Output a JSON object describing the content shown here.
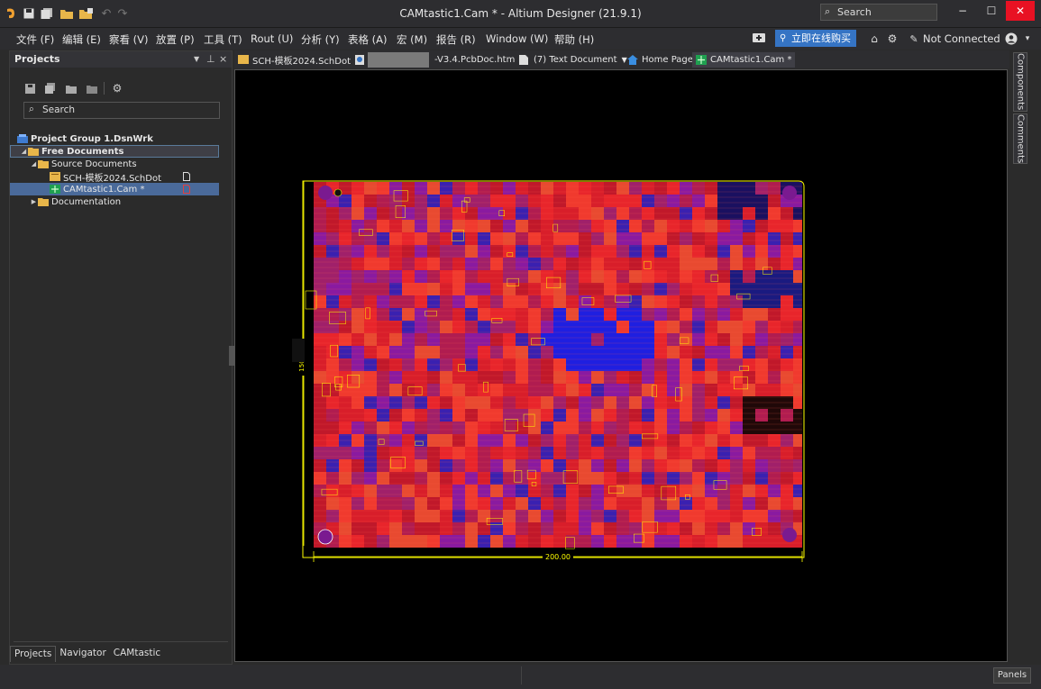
{
  "app": {
    "title": "CAMtastic1.Cam * - Altium Designer (21.9.1)",
    "search_placeholder": "Search"
  },
  "menu": {
    "items": [
      "文件 (F)",
      "编辑 (E)",
      "察看 (V)",
      "放置 (P)",
      "工具 (T)",
      "Rout (U)",
      "分析 (Y)",
      "表格 (A)",
      "宏 (M)",
      "报告 (R)",
      "Window (W)",
      "帮助 (H)"
    ],
    "buy_label": "立即在线购买",
    "connection_status": "Not Connected"
  },
  "projects_panel": {
    "title": "Projects",
    "search_placeholder": "Search",
    "tree": {
      "group": "Project Group 1.DsnWrk",
      "free_documents": "Free Documents",
      "source_documents": "Source Documents",
      "doc1": "SCH-模板2024.SchDot",
      "doc2": "CAMtastic1.Cam *",
      "documentation": "Documentation"
    },
    "bottom_tabs": [
      "Projects",
      "Navigator",
      "CAMtastic"
    ]
  },
  "doc_tabs": [
    {
      "label": "SCH-模板2024.SchDot",
      "icon": "schematic-doc-icon"
    },
    {
      "label": "-V3.4.PcbDoc.htm",
      "icon": "html-doc-icon"
    },
    {
      "label": "(7) Text Document",
      "icon": "text-doc-icon"
    },
    {
      "label": "Home Page",
      "icon": "home-icon"
    },
    {
      "label": "CAMtastic1.Cam *",
      "icon": "cam-doc-icon"
    }
  ],
  "right_panels": [
    "Components",
    "Comments"
  ],
  "board": {
    "width_dimension": "200.00",
    "height_dimension": "150",
    "colors": {
      "outline": "#ffff00",
      "copper_top": "#e8252b",
      "copper_bottom": "#1f1fe0",
      "mixed": "#8a1aa0",
      "pads": "#7a1a90"
    }
  },
  "status": {
    "panels_label": "Panels"
  }
}
